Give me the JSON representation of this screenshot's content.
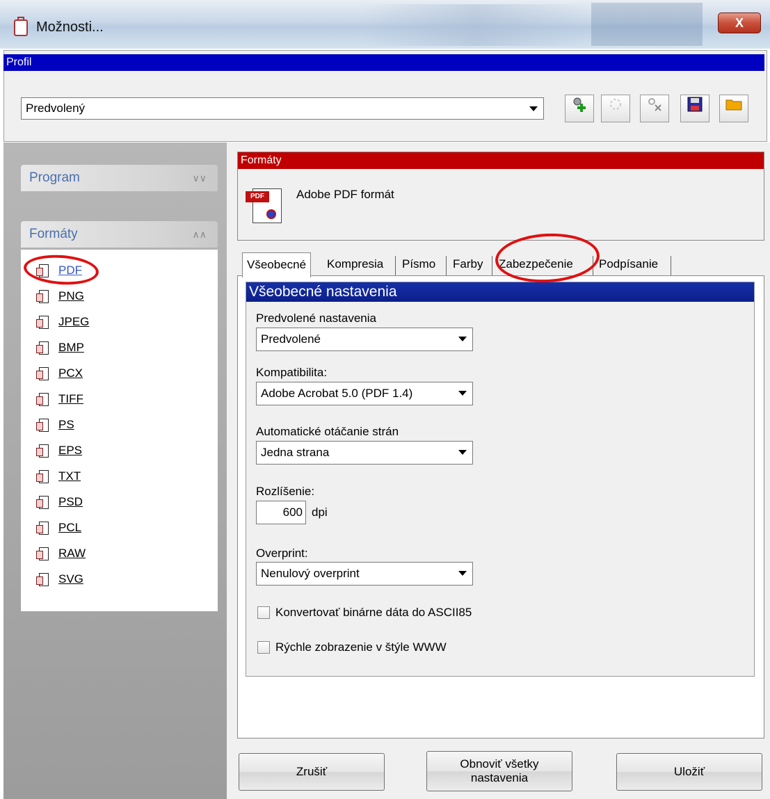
{
  "window": {
    "title": "Možnosti...",
    "close_label": "X"
  },
  "profile": {
    "header": "Profil",
    "selected": "Predvolený",
    "toolbar": [
      "add-profile",
      "rename-profile",
      "delete-profile",
      "save-profile",
      "open-profile"
    ]
  },
  "sidebar": {
    "program_label": "Program",
    "formats_label": "Formáty",
    "formats": [
      "PDF",
      "PNG",
      "JPEG",
      "BMP",
      "PCX",
      "TIFF",
      "PS",
      "EPS",
      "TXT",
      "PSD",
      "PCL",
      "RAW",
      "SVG"
    ],
    "active_format": "PDF"
  },
  "format_panel": {
    "header": "Formáty",
    "icon_tag": "PDF",
    "format_name": "Adobe PDF formát"
  },
  "tabs": [
    "Všeobecné",
    "Kompresia",
    "Písmo",
    "Farby",
    "Zabezpečenie",
    "Podpísanie"
  ],
  "active_tab": "Všeobecné",
  "general": {
    "header": "Všeobecné nastavenia",
    "preset_label": "Predvolené nastavenia",
    "preset_value": "Predvolené",
    "compat_label": "Kompatibilita:",
    "compat_value": "Adobe Acrobat 5.0 (PDF 1.4)",
    "rotate_label": "Automatické otáčanie strán",
    "rotate_value": "Jedna strana",
    "resolution_label": "Rozlíšenie:",
    "resolution_value": "600",
    "resolution_unit": "dpi",
    "overprint_label": "Overprint:",
    "overprint_value": "Nenulový overprint",
    "checkbox_ascii85": "Konvertovať binárne dáta do ASCII85",
    "checkbox_fastweb": "Rýchle zobrazenie v štýle WWW"
  },
  "buttons": {
    "cancel": "Zrušiť",
    "reset_line1": "Obnoviť všetky",
    "reset_line2": "nastavenia",
    "save": "Uložiť"
  },
  "colors": {
    "profile_header": "#0000c0",
    "formats_header": "#c00000",
    "annotation": "#e01010"
  }
}
